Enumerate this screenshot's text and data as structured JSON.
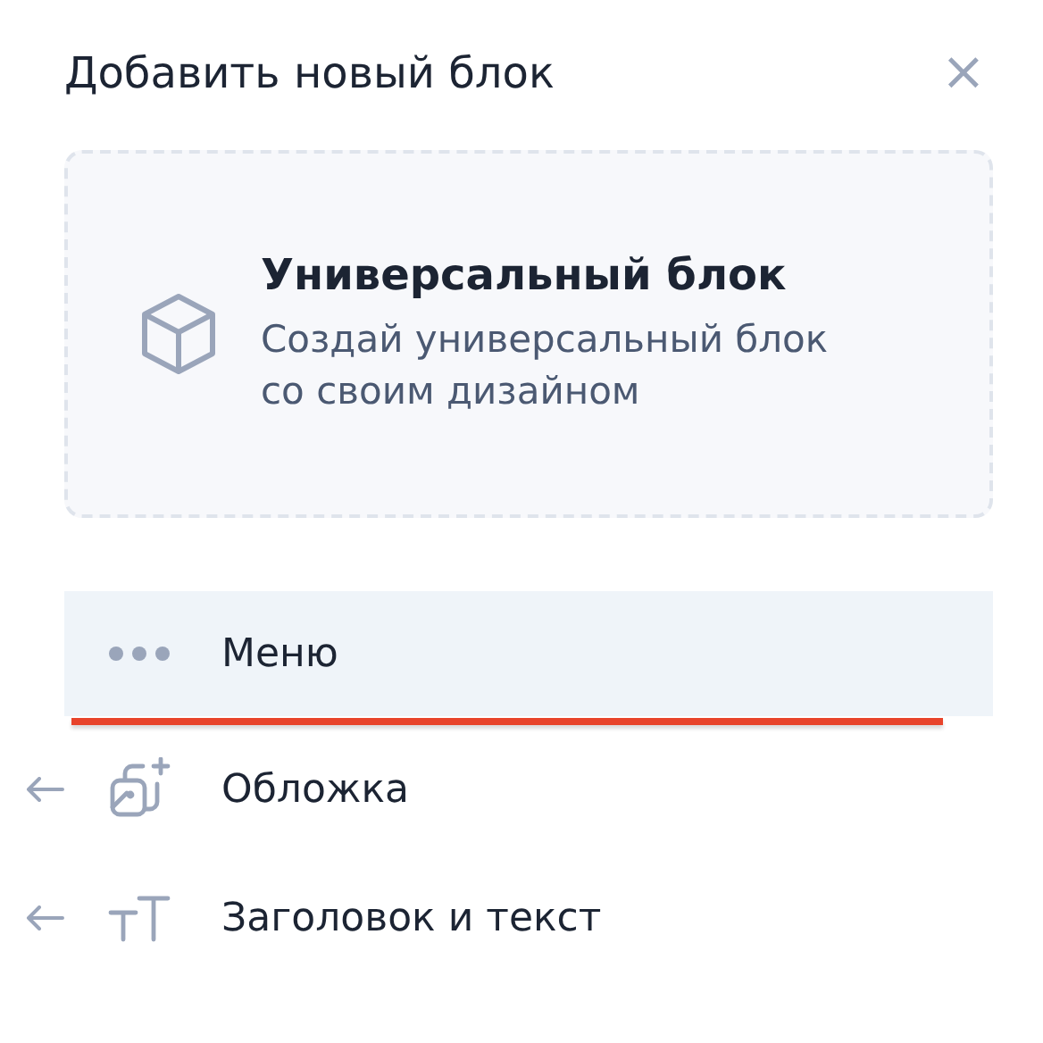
{
  "panel": {
    "title": "Добавить новый блок",
    "close": "×"
  },
  "card": {
    "title": "Универсальный блок",
    "description": "Создай универсальный блок со своим дизайном"
  },
  "items": [
    {
      "kind": "dots",
      "label": "Меню",
      "selected": true
    },
    {
      "kind": "cover",
      "label": "Обложка",
      "selected": false
    },
    {
      "kind": "text",
      "label": "Заголовок и текст",
      "selected": false
    }
  ]
}
